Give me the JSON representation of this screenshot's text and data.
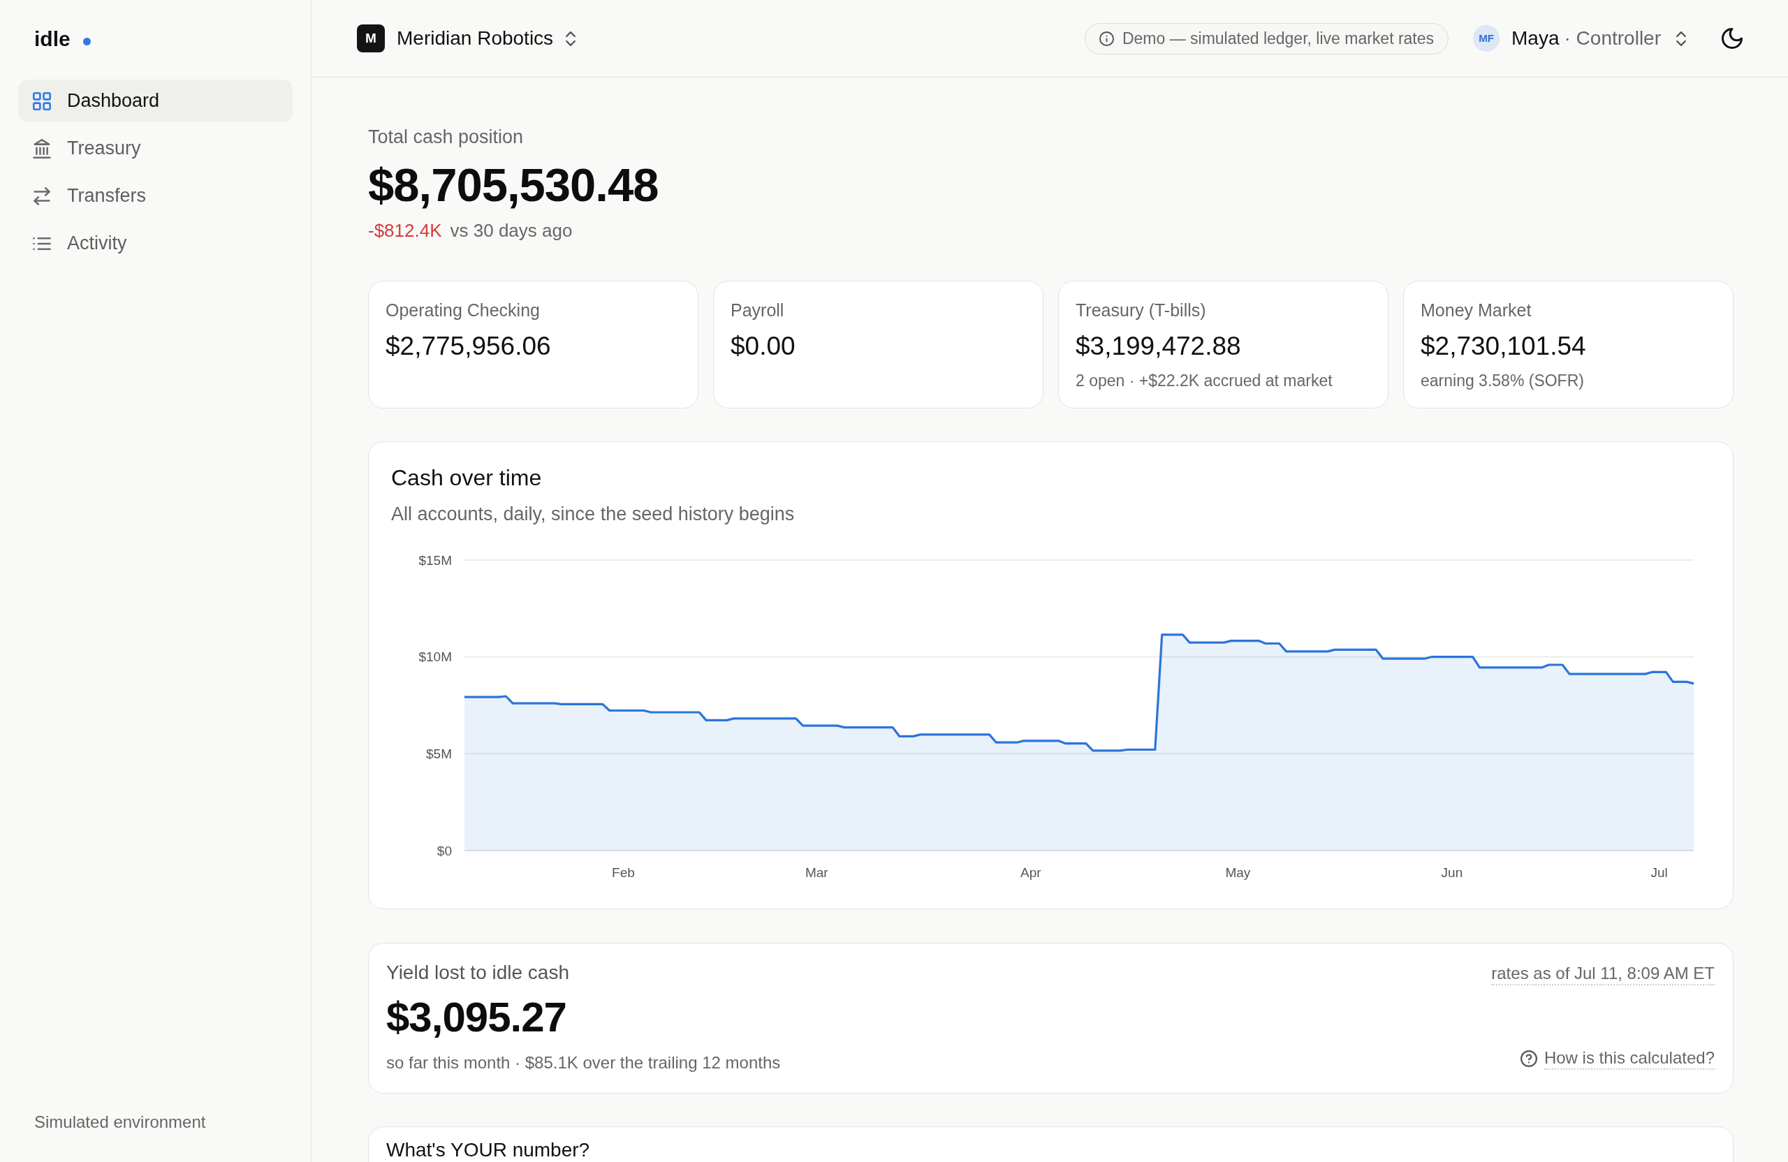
{
  "sidebar": {
    "logo": "idle",
    "items": [
      {
        "label": "Dashboard",
        "selected": true
      },
      {
        "label": "Treasury",
        "selected": false
      },
      {
        "label": "Transfers",
        "selected": false
      },
      {
        "label": "Activity",
        "selected": false
      }
    ],
    "footer": "Simulated environment"
  },
  "topbar": {
    "org": {
      "initial": "M",
      "name": "Meridian Robotics"
    },
    "notice": "Demo — simulated ledger, live market rates",
    "user": {
      "initials": "MF",
      "name": "Maya",
      "role": "· Controller"
    }
  },
  "summary": {
    "label": "Total cash position",
    "amount": "$8,705,530.48",
    "change": "-$812.4K",
    "negative": true,
    "change_note": "vs 30 days ago"
  },
  "accounts": [
    {
      "name": "Operating Checking",
      "balance": "$2,775,956.06"
    },
    {
      "name": "Payroll",
      "balance": "$0.00"
    },
    {
      "name": "Treasury (T-bills)",
      "balance": "$3,199,472.88",
      "note": "2 open · +$22.2K accrued at market"
    },
    {
      "name": "Money Market",
      "balance": "$2,730,101.54",
      "note": "earning 3.58% (SOFR)"
    }
  ],
  "cash_chart": {
    "title": "Cash over time",
    "subtitle": "All accounts, daily, since the seed history begins",
    "chart_data": {
      "type": "area",
      "categories": [
        null,
        null,
        null,
        null,
        null,
        null,
        null,
        null,
        null,
        null,
        null,
        null,
        null,
        null,
        null,
        null,
        null,
        null,
        null,
        null,
        null,
        null,
        null,
        "Feb",
        null,
        null,
        null,
        null,
        null,
        null,
        null,
        null,
        null,
        null,
        null,
        null,
        null,
        null,
        null,
        null,
        null,
        null,
        null,
        null,
        null,
        null,
        null,
        null,
        null,
        null,
        null,
        "Mar",
        null,
        null,
        null,
        null,
        null,
        null,
        null,
        null,
        null,
        null,
        null,
        null,
        null,
        null,
        null,
        null,
        null,
        null,
        null,
        null,
        null,
        null,
        null,
        null,
        null,
        null,
        null,
        null,
        null,
        null,
        "Apr",
        null,
        null,
        null,
        null,
        null,
        null,
        null,
        null,
        null,
        null,
        null,
        null,
        null,
        null,
        null,
        null,
        null,
        null,
        null,
        null,
        null,
        null,
        null,
        null,
        null,
        null,
        null,
        null,
        null,
        "May",
        null,
        null,
        null,
        null,
        null,
        null,
        null,
        null,
        null,
        null,
        null,
        null,
        null,
        null,
        null,
        null,
        null,
        null,
        null,
        null,
        null,
        null,
        null,
        null,
        null,
        null,
        null,
        null,
        null,
        null,
        "Jun",
        null,
        null,
        null,
        null,
        null,
        null,
        null,
        null,
        null,
        null,
        null,
        null,
        null,
        null,
        null,
        null,
        null,
        null,
        null,
        null,
        null,
        null,
        null,
        null,
        null,
        null,
        null,
        null,
        null,
        "Jul",
        null,
        null,
        null,
        null,
        null
      ],
      "series": [
        {
          "color": "#2b74dc",
          "values": [
            7.93,
            7.93,
            7.93,
            7.93,
            7.93,
            7.93,
            7.97,
            7.6,
            7.6,
            7.6,
            7.6,
            7.6,
            7.6,
            7.6,
            7.56,
            7.56,
            7.56,
            7.56,
            7.56,
            7.56,
            7.56,
            7.23,
            7.23,
            7.23,
            7.23,
            7.23,
            7.23,
            7.14,
            7.14,
            7.14,
            7.14,
            7.14,
            7.14,
            7.14,
            7.14,
            6.73,
            6.73,
            6.73,
            6.73,
            6.82,
            6.82,
            6.82,
            6.82,
            6.82,
            6.82,
            6.82,
            6.82,
            6.82,
            6.82,
            6.45,
            6.45,
            6.45,
            6.45,
            6.45,
            6.45,
            6.36,
            6.36,
            6.36,
            6.36,
            6.36,
            6.36,
            6.36,
            6.36,
            5.9,
            5.9,
            5.9,
            5.99,
            5.99,
            5.99,
            5.99,
            5.99,
            5.99,
            5.99,
            5.99,
            5.99,
            5.99,
            5.99,
            5.58,
            5.58,
            5.58,
            5.58,
            5.67,
            5.67,
            5.67,
            5.67,
            5.67,
            5.67,
            5.53,
            5.53,
            5.53,
            5.53,
            5.16,
            5.16,
            5.16,
            5.16,
            5.16,
            5.21,
            5.21,
            5.21,
            5.21,
            5.21,
            11.15,
            11.15,
            11.15,
            11.15,
            10.74,
            10.74,
            10.74,
            10.74,
            10.74,
            10.74,
            10.83,
            10.83,
            10.83,
            10.83,
            10.83,
            10.69,
            10.69,
            10.69,
            10.28,
            10.28,
            10.28,
            10.28,
            10.28,
            10.28,
            10.28,
            10.37,
            10.37,
            10.37,
            10.37,
            10.37,
            10.37,
            10.37,
            9.91,
            9.91,
            9.91,
            9.91,
            9.91,
            9.91,
            9.91,
            10.0,
            10.0,
            10.0,
            10.0,
            10.0,
            10.0,
            10.0,
            9.45,
            9.45,
            9.45,
            9.45,
            9.45,
            9.45,
            9.45,
            9.45,
            9.45,
            9.45,
            9.59,
            9.59,
            9.59,
            9.12,
            9.12,
            9.12,
            9.12,
            9.12,
            9.12,
            9.12,
            9.12,
            9.12,
            9.12,
            9.12,
            9.12,
            9.22,
            9.22,
            9.22,
            8.71,
            8.71,
            8.71,
            8.62
          ]
        }
      ],
      "ylim": [
        0,
        15
      ],
      "yticks": [
        {
          "value": 0,
          "label": "$0"
        },
        {
          "value": 5,
          "label": "$5M"
        },
        {
          "value": 10,
          "label": "$10M"
        },
        {
          "value": 15,
          "label": "$15M"
        }
      ]
    }
  },
  "yield_card": {
    "title": "Yield lost to idle cash",
    "amount": "$3,095.27",
    "detail": "so far this month · $85.1K over the trailing 12 months",
    "rates_note": "rates as of Jul 11, 8:09 AM ET",
    "help_link": "How is this calculated?"
  },
  "next_card": {
    "title": "What's YOUR number?"
  }
}
